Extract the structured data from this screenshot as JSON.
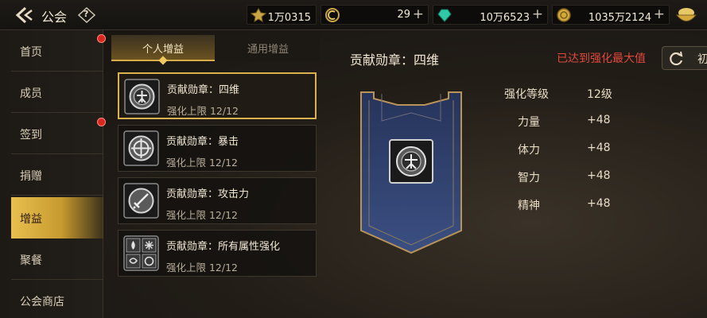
{
  "header": {
    "title": "公会",
    "help_label": "?",
    "resources": [
      {
        "icon": "gold-bar-icon",
        "value": "1万0315"
      },
      {
        "icon": "c-coin-icon",
        "value": "29"
      },
      {
        "icon": "gem-icon",
        "value": "10万6523"
      },
      {
        "icon": "gold-coin-icon",
        "value": "1035万2124"
      }
    ],
    "extra_icon": "treasure-bowl-icon"
  },
  "sidebar": {
    "items": [
      {
        "label": "首页",
        "dot": true
      },
      {
        "label": "成员",
        "dot": false
      },
      {
        "label": "签到",
        "dot": true
      },
      {
        "label": "捐赠",
        "dot": false
      },
      {
        "label": "增益",
        "active": true
      },
      {
        "label": "聚餐",
        "dot": false
      },
      {
        "label": "公会商店",
        "dot": false
      }
    ]
  },
  "tabs": [
    {
      "label": "个人增益",
      "active": true
    },
    {
      "label": "通用增益",
      "active": false
    }
  ],
  "buffs": [
    {
      "name": "贡献勋章：四维",
      "limit": "强化上限 12/12",
      "icon": "four-stats-medal-icon"
    },
    {
      "name": "贡献勋章：暴击",
      "limit": "强化上限 12/12",
      "icon": "crit-medal-icon"
    },
    {
      "name": "贡献勋章：攻击力",
      "limit": "强化上限 12/12",
      "icon": "sword-medal-icon"
    },
    {
      "name": "贡献勋章：所有属性强化",
      "limit": "强化上限 12/12",
      "icon": "all-elements-medal-icon"
    }
  ],
  "detail": {
    "title": "贡献勋章：四维",
    "status": "已达到强化最大值",
    "refresh_label": "初",
    "stats": [
      {
        "name": "强化等级",
        "value": "12级"
      },
      {
        "name": "力量",
        "value": "+48"
      },
      {
        "name": "体力",
        "value": "+48"
      },
      {
        "name": "智力",
        "value": "+48"
      },
      {
        "name": "精神",
        "value": "+48"
      }
    ]
  },
  "colors": {
    "accent_gold": "#d9b24f",
    "status_red": "#e0493c",
    "notify_dot": "#d9261f"
  }
}
